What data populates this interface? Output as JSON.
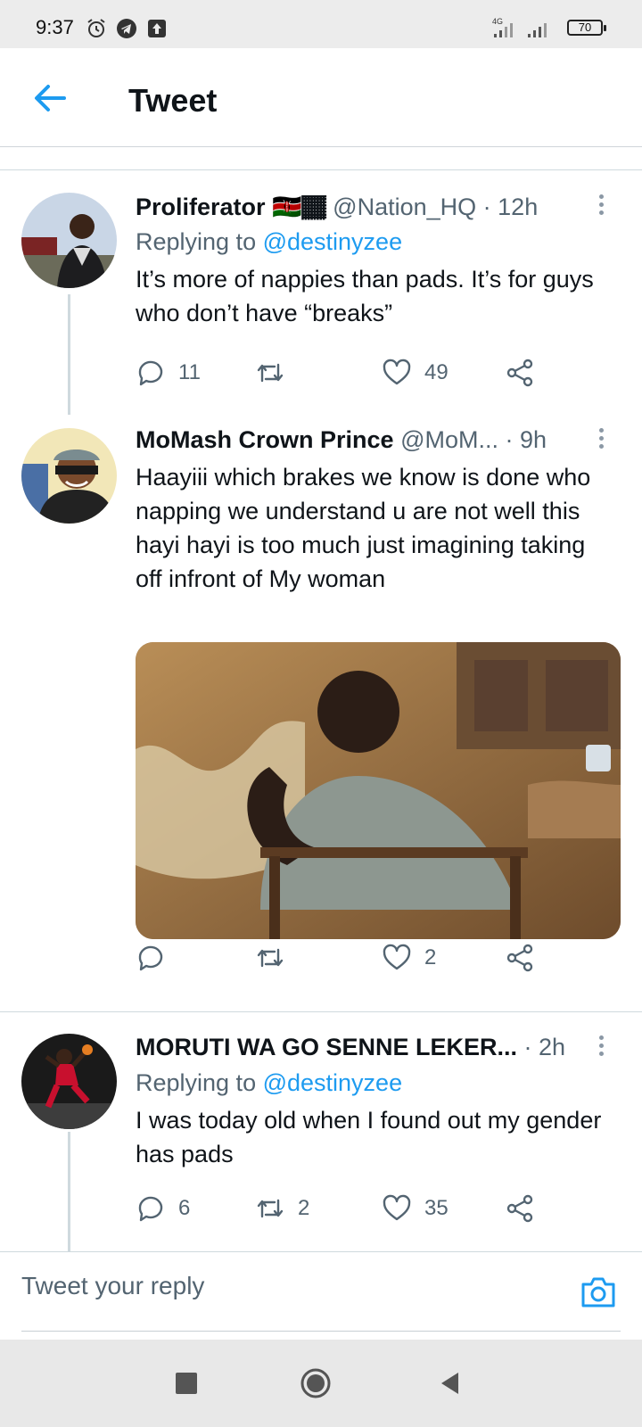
{
  "status_bar": {
    "time": "9:37",
    "network": "4G",
    "battery": "70"
  },
  "header": {
    "title": "Tweet"
  },
  "tweets": [
    {
      "name": "Proliferator 🇰🇪🏾",
      "handle": "@Nation_HQ",
      "time": "· 12h",
      "reply_prefix": "Replying to ",
      "reply_to": "@destinyzee",
      "text": "It’s more of nappies than pads. It’s for guys who don’t have “breaks”",
      "replies": "11",
      "retweets": "",
      "likes": "49"
    },
    {
      "name": "MoMash Crown Prince",
      "handle": "@MoM...",
      "time": "· 9h",
      "text": "Haayiii which brakes we know is done who\n napping we understand u are not well this hayi hayi is too much just imagining taking off infront of My woman",
      "replies": "",
      "retweets": "",
      "likes": "2"
    },
    {
      "name": "MORUTI WA GO SENNE LEKER...",
      "handle": "",
      "time": "· 2h",
      "reply_prefix": "Replying to ",
      "reply_to": "@destinyzee",
      "text": "I was today old when I found out my gender has pads",
      "replies": "6",
      "retweets": "2",
      "likes": "35"
    }
  ],
  "reply_bar": {
    "placeholder": "Tweet your reply"
  },
  "colors": {
    "accent": "#1d9bf0",
    "text": "#0f1419",
    "muted": "#536471"
  }
}
